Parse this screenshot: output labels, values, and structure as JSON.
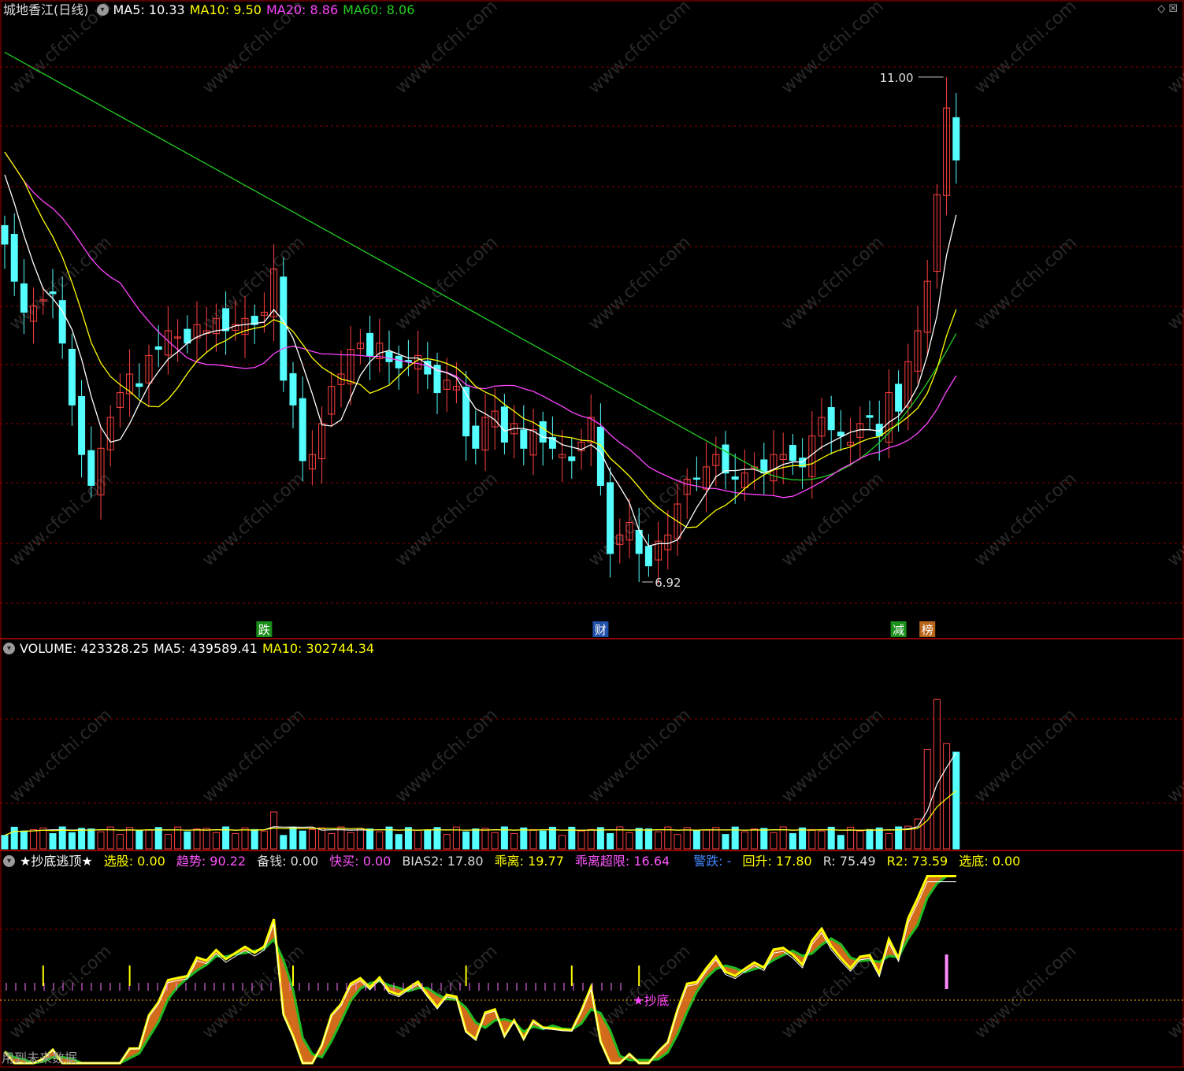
{
  "main_panel": {
    "stock_title": "城地香江(日线)",
    "ma5": "MA5: 10.33",
    "ma10": "MA10: 9.50",
    "ma20": "MA20: 8.86",
    "ma60": "MA60: 8.06",
    "high_label": "11.00",
    "low_label": "6.92",
    "markers": [
      {
        "text": "跌",
        "color": "#1a8f1a"
      },
      {
        "text": "财",
        "color": "#2050a8"
      },
      {
        "text": "减",
        "color": "#1a8f1a"
      },
      {
        "text": "榜",
        "color": "#b8651a"
      }
    ]
  },
  "volume_panel": {
    "volume": "VOLUME: 423328.25",
    "ma5": "MA5: 439589.41",
    "ma10": "MA10: 302744.34"
  },
  "indicator_panel": {
    "name": "★抄底逃顶★",
    "items": [
      {
        "text": "选股: 0.00",
        "color": "#ffff00"
      },
      {
        "text": "趋势: 90.22",
        "color": "#ff55ff"
      },
      {
        "text": "备钱: 0.00",
        "color": "#dddddd"
      },
      {
        "text": "快买: 0.00",
        "color": "#ff55ff"
      },
      {
        "text": "BIAS2: 17.80",
        "color": "#dddddd"
      },
      {
        "text": "乖离: 19.77",
        "color": "#ffff00"
      },
      {
        "text": "乖离超限: 16.64",
        "color": "#ff55ff"
      },
      {
        "text": "警跌: -",
        "color": "#4488ff"
      },
      {
        "text": "回升: 17.80",
        "color": "#ffff00"
      },
      {
        "text": "R: 75.49",
        "color": "#dddddd"
      },
      {
        "text": "R2: 73.59",
        "color": "#ffff00"
      },
      {
        "text": "选底: 0.00",
        "color": "#ffff00"
      }
    ],
    "signal_label": "★抄底"
  },
  "footer_text": "用到未来数据",
  "colors": {
    "up": "#ff4040",
    "down": "#55ffff",
    "ma5": "#ffffff",
    "ma10": "#ffff00",
    "ma20": "#ff44ff",
    "ma60": "#22cc22",
    "grid": "#8a0000"
  },
  "chart_data": {
    "type": "candlestick",
    "title": "城地香江(日线)",
    "price_range": [
      6.5,
      11.4
    ],
    "bars": 100,
    "low": 6.92,
    "high": 11.0,
    "closes": [
      9.65,
      9.35,
      9.1,
      9.15,
      9.2,
      9.25,
      8.85,
      8.35,
      7.95,
      7.7,
      8.0,
      8.25,
      8.45,
      8.6,
      8.5,
      8.75,
      8.8,
      8.95,
      8.9,
      8.85,
      9.0,
      8.95,
      9.05,
      8.95,
      9.0,
      9.05,
      9.0,
      9.1,
      9.45,
      8.55,
      8.35,
      7.9,
      7.95,
      8.2,
      8.5,
      8.6,
      8.8,
      8.85,
      8.75,
      8.85,
      8.7,
      8.65,
      8.7,
      8.75,
      8.6,
      8.45,
      8.55,
      8.5,
      8.1,
      8.0,
      8.25,
      8.3,
      8.05,
      8.2,
      8.0,
      8.15,
      8.05,
      8.0,
      7.95,
      7.9,
      8.05,
      8.25,
      7.7,
      7.15,
      7.3,
      7.4,
      7.15,
      7.05,
      7.25,
      7.3,
      7.55,
      7.75,
      7.75,
      7.85,
      7.95,
      7.8,
      7.75,
      7.8,
      7.85,
      7.8,
      7.95,
      7.95,
      7.9,
      7.85,
      8.1,
      8.25,
      8.15,
      8.1,
      8.05,
      8.2,
      8.25,
      8.1,
      8.45,
      8.3,
      8.7,
      8.95,
      9.35,
      10.05,
      10.75,
      10.33
    ],
    "volume_range": [
      0,
      1300000
    ]
  }
}
